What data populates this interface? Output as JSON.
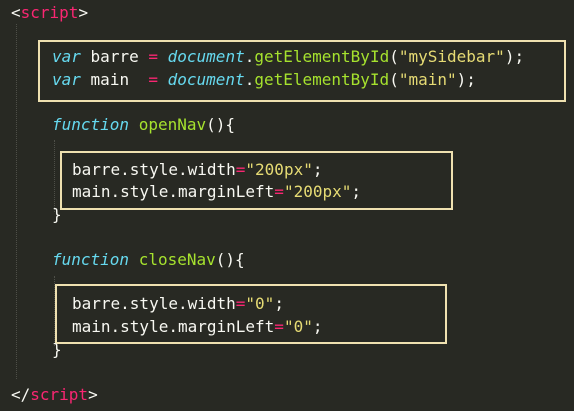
{
  "colors": {
    "background": "#282923",
    "tag": "#f92672",
    "keyword": "#66d9ef",
    "function_name": "#a6e22e",
    "string": "#e6db74",
    "operator": "#f92672",
    "text": "#f8f8f2",
    "highlight_box": "#efe1b0"
  },
  "code": {
    "script_open": {
      "lt": "<",
      "tag": "script",
      "gt": ">"
    },
    "var_barre": {
      "keyword": "var",
      "name": "barre",
      "op": "=",
      "object": "document",
      "dot": ".",
      "method": "getElementById",
      "open": "(",
      "arg": "\"mySidebar\"",
      "close": ");"
    },
    "var_main": {
      "keyword": "var",
      "name": "main",
      "op": "=",
      "object": "document",
      "dot": ".",
      "method": "getElementById",
      "open": "(",
      "arg": "\"main\"",
      "close": ");"
    },
    "open_nav": {
      "keyword": "function",
      "name": "openNav",
      "paren_brace": "(){",
      "line1": {
        "target": "barre.style.width",
        "op": "=",
        "value": "\"200px\"",
        "end": ";"
      },
      "line2": {
        "target": "main.style.marginLeft",
        "op": "=",
        "value": "\"200px\"",
        "end": ";"
      },
      "close_brace": "}"
    },
    "close_nav": {
      "keyword": "function",
      "name": "closeNav",
      "paren_brace": "(){",
      "line1": {
        "target": "barre.style.width",
        "op": "=",
        "value": "\"0\"",
        "end": ";"
      },
      "line2": {
        "target": "main.style.marginLeft",
        "op": "=",
        "value": "\"0\"",
        "end": ";"
      },
      "close_brace": "}"
    },
    "script_close": {
      "lt": "</",
      "tag": "script",
      "gt": ">"
    }
  }
}
